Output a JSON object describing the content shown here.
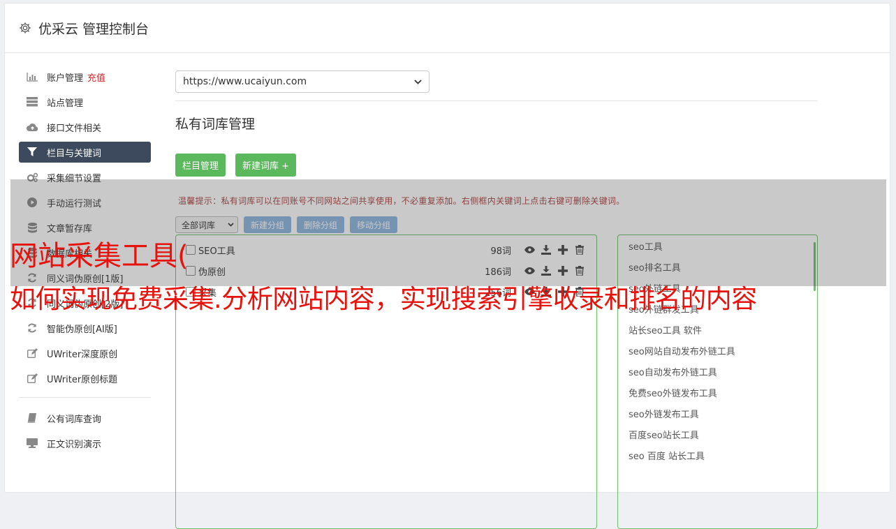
{
  "header": {
    "title": "优采云 管理控制台",
    "icon": "gear-icon"
  },
  "sidebar": {
    "items": [
      {
        "label": "账户管理",
        "extra": "充值",
        "icon": "bar-chart-icon"
      },
      {
        "label": "站点管理",
        "icon": "server-icon"
      },
      {
        "label": "接口文件相关",
        "icon": "cloud-upload-icon"
      },
      {
        "label": "栏目与关键词",
        "icon": "filter-icon"
      },
      {
        "label": "采集细节设置",
        "icon": "cogs-icon"
      },
      {
        "label": "手动运行测试",
        "icon": "play-circle-icon"
      },
      {
        "label": "文章暂存库",
        "icon": "database-icon"
      },
      {
        "label": "数据库相关",
        "icon": "database-icon"
      },
      {
        "label": "同义词伪原创[1版]",
        "icon": "refresh-icon"
      },
      {
        "label": "同义词伪原创[2版]",
        "icon": "refresh-icon"
      },
      {
        "label": "智能伪原创[AI版]",
        "icon": "refresh-icon"
      },
      {
        "label": "UWriter深度原创",
        "icon": "edit-icon"
      },
      {
        "label": "UWriter原创标题",
        "icon": "edit-icon"
      }
    ],
    "items2": [
      {
        "label": "公有词库查询",
        "icon": "book-icon"
      },
      {
        "label": "正文识别演示",
        "icon": "monitor-icon"
      }
    ]
  },
  "main": {
    "site_select": "https://www.ucaiyun.com",
    "section_title": "私有词库管理",
    "btn_column": "栏目管理",
    "btn_new_lib": "新建词库 +",
    "tip": "温馨提示：私有词库可以在同账号不同网站之间共享使用，不必重复添加。右侧框内关键词上点击右键可删除关键词。",
    "lib_filter": "全部词库",
    "btn_new_group": "新建分组",
    "btn_del_group": "删除分组",
    "btn_move_group": "移动分组",
    "libraries": [
      {
        "name": "SEO工具",
        "count": "98词"
      },
      {
        "name": "伪原创",
        "count": "186词"
      },
      {
        "name": "采集",
        "count": "256词"
      }
    ],
    "keywords": [
      "seo工具",
      "seo排名工具",
      "seo外链工具",
      "seo外链群发工具",
      "站长seo工具 软件",
      "seo网站自动发布外链工具",
      "seo自动发布外链工具",
      "免费seo外链发布工具",
      "seo外链发布工具",
      "百度seo站长工具",
      "seo 百度 站长工具"
    ]
  },
  "overlay": {
    "line1": "网站采集工具(",
    "line2": "如何实现免费采集.分析网站内容，实现搜索引擎收录和排名的内容"
  }
}
